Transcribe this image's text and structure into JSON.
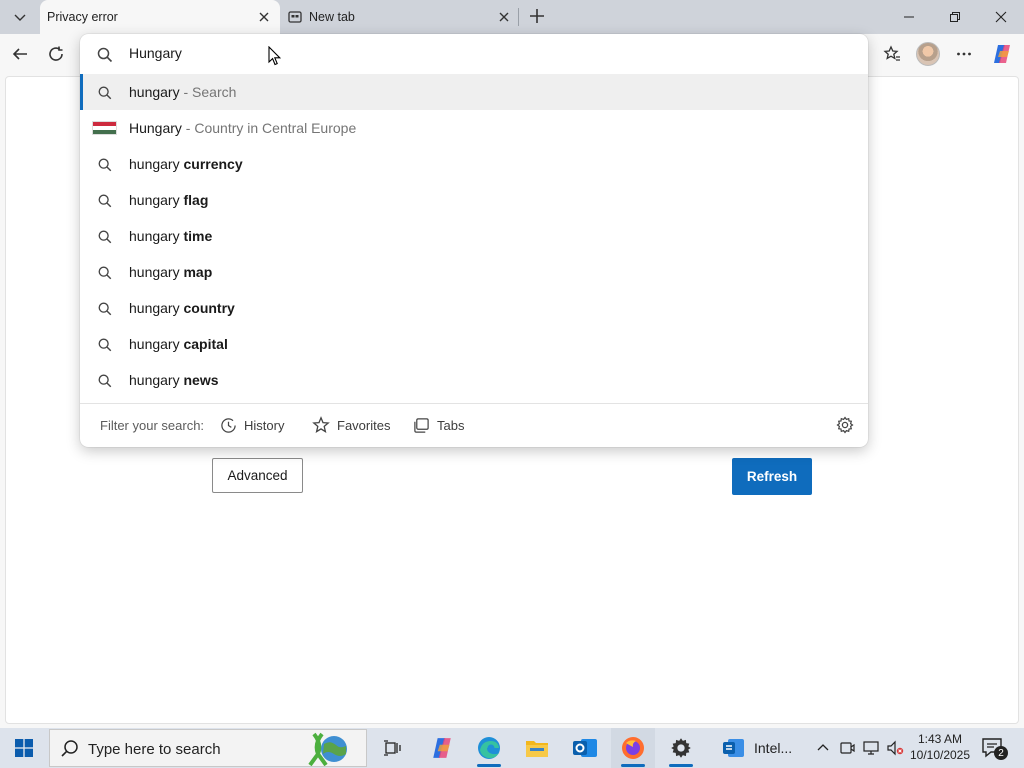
{
  "tabs": [
    {
      "title": "Privacy error",
      "active": true
    },
    {
      "title": "New tab",
      "active": false
    }
  ],
  "address_bar": {
    "value": "Hungary"
  },
  "suggestions": [
    {
      "icon": "search-icon",
      "prefix": "hungary",
      "bold": "",
      "sub": " - Search",
      "selected": true
    },
    {
      "icon": "hungary-flag-icon",
      "prefix": "Hungary",
      "bold": "",
      "sub": " - Country in Central Europe",
      "selected": false
    },
    {
      "icon": "search-icon",
      "prefix": "hungary ",
      "bold": "currency",
      "sub": "",
      "selected": false
    },
    {
      "icon": "search-icon",
      "prefix": "hungary ",
      "bold": "flag",
      "sub": "",
      "selected": false
    },
    {
      "icon": "search-icon",
      "prefix": "hungary ",
      "bold": "time",
      "sub": "",
      "selected": false
    },
    {
      "icon": "search-icon",
      "prefix": "hungary ",
      "bold": "map",
      "sub": "",
      "selected": false
    },
    {
      "icon": "search-icon",
      "prefix": "hungary ",
      "bold": "country",
      "sub": "",
      "selected": false
    },
    {
      "icon": "search-icon",
      "prefix": "hungary ",
      "bold": "capital",
      "sub": "",
      "selected": false
    },
    {
      "icon": "search-icon",
      "prefix": "hungary ",
      "bold": "news",
      "sub": "",
      "selected": false
    }
  ],
  "filter": {
    "label": "Filter your search:",
    "history": "History",
    "favorites": "Favorites",
    "tabs": "Tabs"
  },
  "page": {
    "advanced_label": "Advanced",
    "refresh_label": "Refresh"
  },
  "taskbar": {
    "search_placeholder": "Type here to search",
    "app_label": "Intel...",
    "time": "1:43 AM",
    "date": "10/10/2025",
    "notification_count": "2"
  },
  "colors": {
    "accent": "#0f6cbd",
    "flag_red": "#cd2a3e",
    "flag_white": "#ffffff",
    "flag_green": "#436f4d"
  }
}
